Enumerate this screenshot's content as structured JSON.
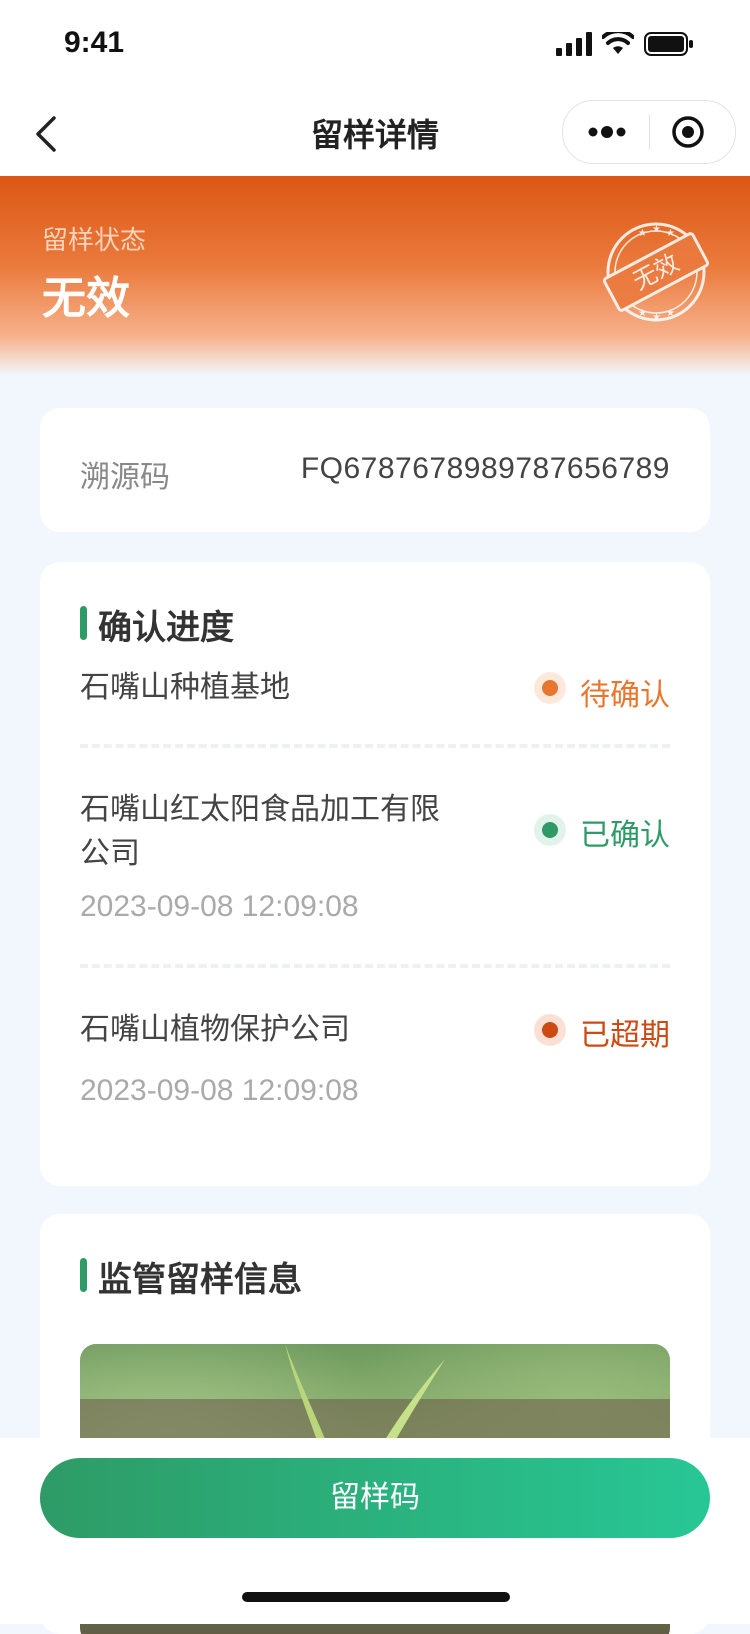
{
  "status_bar": {
    "time": "9:41"
  },
  "nav": {
    "title": "留样详情"
  },
  "header": {
    "status_label": "留样状态",
    "status_value": "无效",
    "stamp_text": "无效"
  },
  "trace": {
    "label": "溯源码",
    "value": "FQ6787678989787656789"
  },
  "progress": {
    "title": "确认进度",
    "rows": [
      {
        "name": "石嘴山种植基地",
        "time": "",
        "status": "待确认"
      },
      {
        "name_line1": "石嘴山红太阳食品加工有限",
        "name_line2": "公司",
        "time": "2023-09-08 12:09:08",
        "status": "已确认"
      },
      {
        "name": "石嘴山植物保护公司",
        "time": "2023-09-08 12:09:08",
        "status": "已超期"
      }
    ]
  },
  "info": {
    "title": "监管留样信息"
  },
  "bottom": {
    "button_label": "留样码"
  },
  "colors": {
    "primary": "#2e9b66",
    "pending": "#e8762f",
    "overdue": "#cc4a14",
    "header": "#dc5714"
  }
}
